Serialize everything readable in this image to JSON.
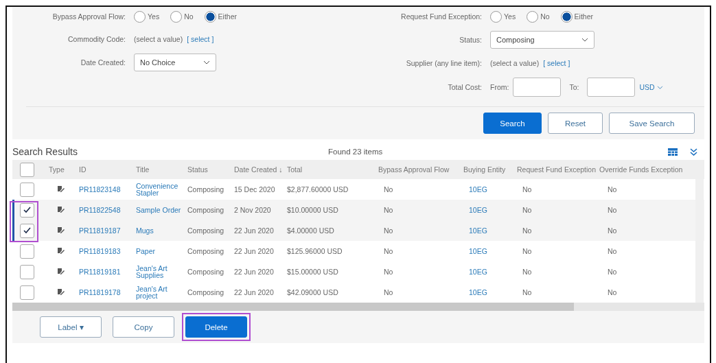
{
  "filters": {
    "radio_rows": [
      {
        "label": "Bypass Approval Flow:",
        "options": [
          {
            "label": "Yes",
            "selected": false
          },
          {
            "label": "No",
            "selected": false
          },
          {
            "label": "Either",
            "selected": true
          }
        ]
      },
      {
        "label": "Request Fund Exception:",
        "options": [
          {
            "label": "Yes",
            "selected": false
          },
          {
            "label": "No",
            "selected": false
          },
          {
            "label": "Either",
            "selected": true
          }
        ]
      }
    ],
    "commodity_code": {
      "label": "Commodity Code:",
      "value": "(select a value)",
      "link": "[ select ]"
    },
    "date_created": {
      "label": "Date Created:",
      "value": "No Choice"
    },
    "status": {
      "label": "Status:",
      "value": "Composing"
    },
    "supplier": {
      "label": "Supplier (any line item):",
      "value": "(select a value)",
      "link": "[ select ]"
    },
    "total_cost": {
      "label": "Total Cost:",
      "from_label": "From:",
      "to_label": "To:",
      "currency": "USD"
    },
    "buttons": [
      {
        "label": "Search",
        "primary": true
      },
      {
        "label": "Reset",
        "primary": false
      },
      {
        "label": "Save Search",
        "primary": false
      }
    ]
  },
  "results": {
    "title": "Search Results",
    "count": "Found 23 items",
    "all_checked": false,
    "columns": [
      "Type",
      "ID",
      "Title",
      "Status",
      "Date Created ↓",
      "Total",
      "Bypass Approval Flow",
      "Buying Entity",
      "Request Fund Exception",
      "Override Funds Exception"
    ],
    "rows": [
      {
        "checked": false,
        "id": "PR11823148",
        "title": "Convenience Stapler",
        "status": "Composing",
        "date": "15 Dec 2020",
        "total": "$2,877.60000 USD",
        "bypass": "No",
        "entity": "10EG",
        "request": "No",
        "override": "No"
      },
      {
        "checked": true,
        "id": "PR11822548",
        "title": "Sample Order",
        "status": "Composing",
        "date": "2 Nov 2020",
        "total": "$10.00000 USD",
        "bypass": "No",
        "entity": "10EG",
        "request": "No",
        "override": "No"
      },
      {
        "checked": true,
        "id": "PR11819187",
        "title": "Mugs",
        "status": "Composing",
        "date": "22 Jun 2020",
        "total": "$4.00000 USD",
        "bypass": "No",
        "entity": "10EG",
        "request": "No",
        "override": "No"
      },
      {
        "checked": false,
        "id": "PR11819183",
        "title": "Paper",
        "status": "Composing",
        "date": "22 Jun 2020",
        "total": "$125.96000 USD",
        "bypass": "No",
        "entity": "10EG",
        "request": "No",
        "override": "No"
      },
      {
        "checked": false,
        "id": "PR11819181",
        "title": "Jean's Art Supplies",
        "status": "Composing",
        "date": "22 Jun 2020",
        "total": "$15.00000 USD",
        "bypass": "No",
        "entity": "10EG",
        "request": "No",
        "override": "No"
      },
      {
        "checked": false,
        "id": "PR11819178",
        "title": "Jean's Art project",
        "status": "Composing",
        "date": "22 Jun 2020",
        "total": "$42.09000 USD",
        "bypass": "No",
        "entity": "10EG",
        "request": "No",
        "override": "No"
      }
    ],
    "actions": [
      {
        "label": "Label ▾",
        "primary": false,
        "highlighted": false
      },
      {
        "label": "Copy",
        "primary": false,
        "highlighted": false
      },
      {
        "label": "Delete",
        "primary": true,
        "highlighted": true
      }
    ]
  }
}
